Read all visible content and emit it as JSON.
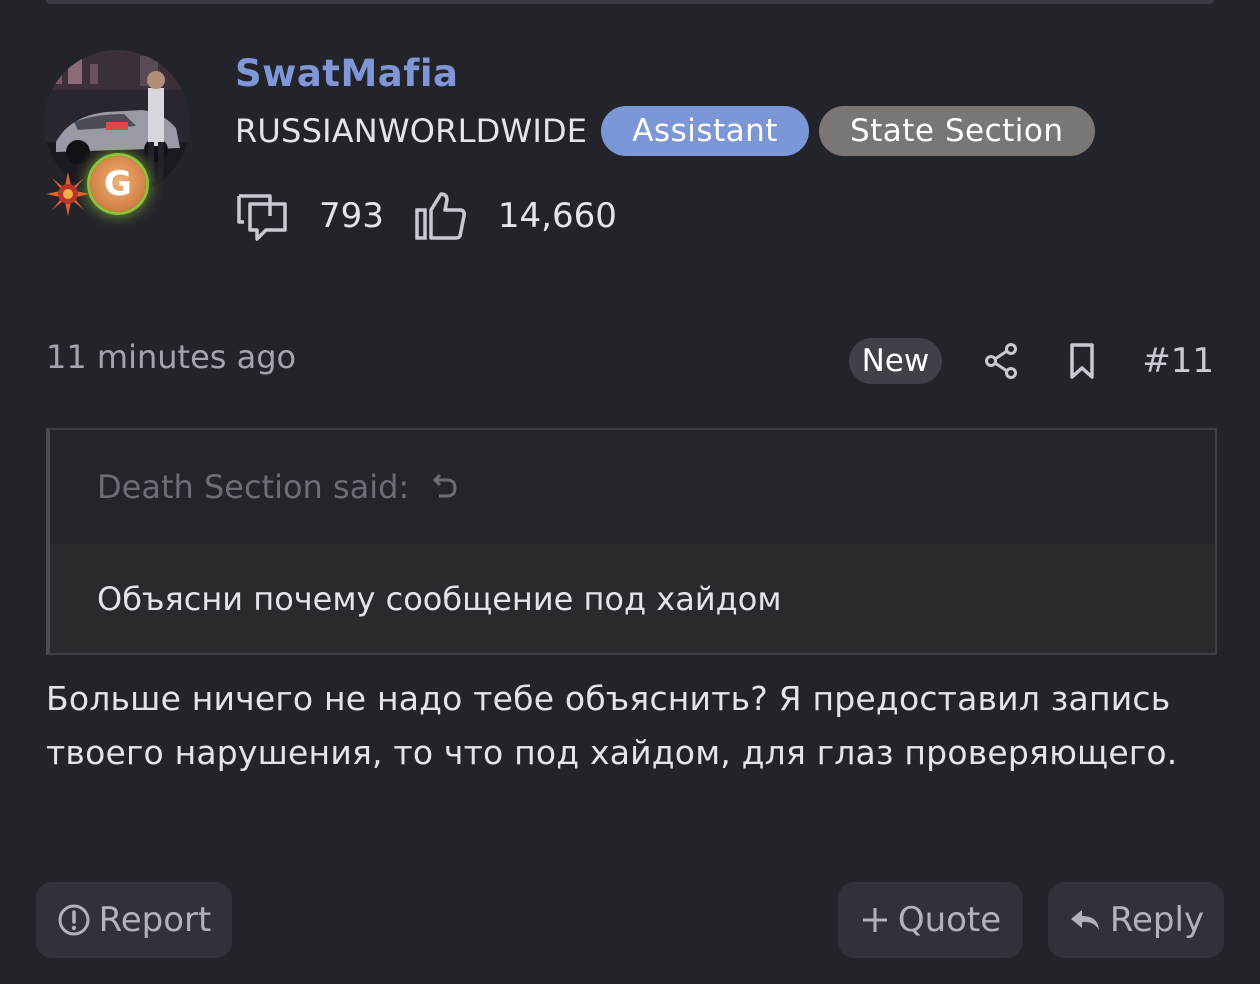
{
  "user": {
    "name": "SwatMafia",
    "title": "RUSSIANWORLDWIDE",
    "banners": [
      "Assistant",
      "State Section"
    ],
    "stats": {
      "messages": "793",
      "reactions": "14,660"
    },
    "badge_letter": "G"
  },
  "post": {
    "time": "11 minutes ago",
    "new_label": "New",
    "number": "#11",
    "quote": {
      "author": "Death Section said:",
      "text": "Объясни почему сообщение под хайдом"
    },
    "message": "Больше ничего не надо тебе объяснить? Я предоставил запись твоего нарушения, то что под хайдом, для глаз проверяющего."
  },
  "actions": {
    "report": "Report",
    "quote": "Quote",
    "reply": "Reply"
  },
  "colors": {
    "background": "#23242a",
    "username": "#7f97d9",
    "assistant_banner": "#7c97d8",
    "state_banner": "#7a7673"
  },
  "icons": {
    "messages": "speech-bubbles-icon",
    "reactions": "thumbs-up-icon",
    "share": "share-icon",
    "bookmark": "bookmark-icon",
    "quote_link": "arrow-return-icon",
    "report": "exclamation-circle-icon",
    "quote": "plus-icon",
    "reply": "reply-arrow-icon"
  }
}
